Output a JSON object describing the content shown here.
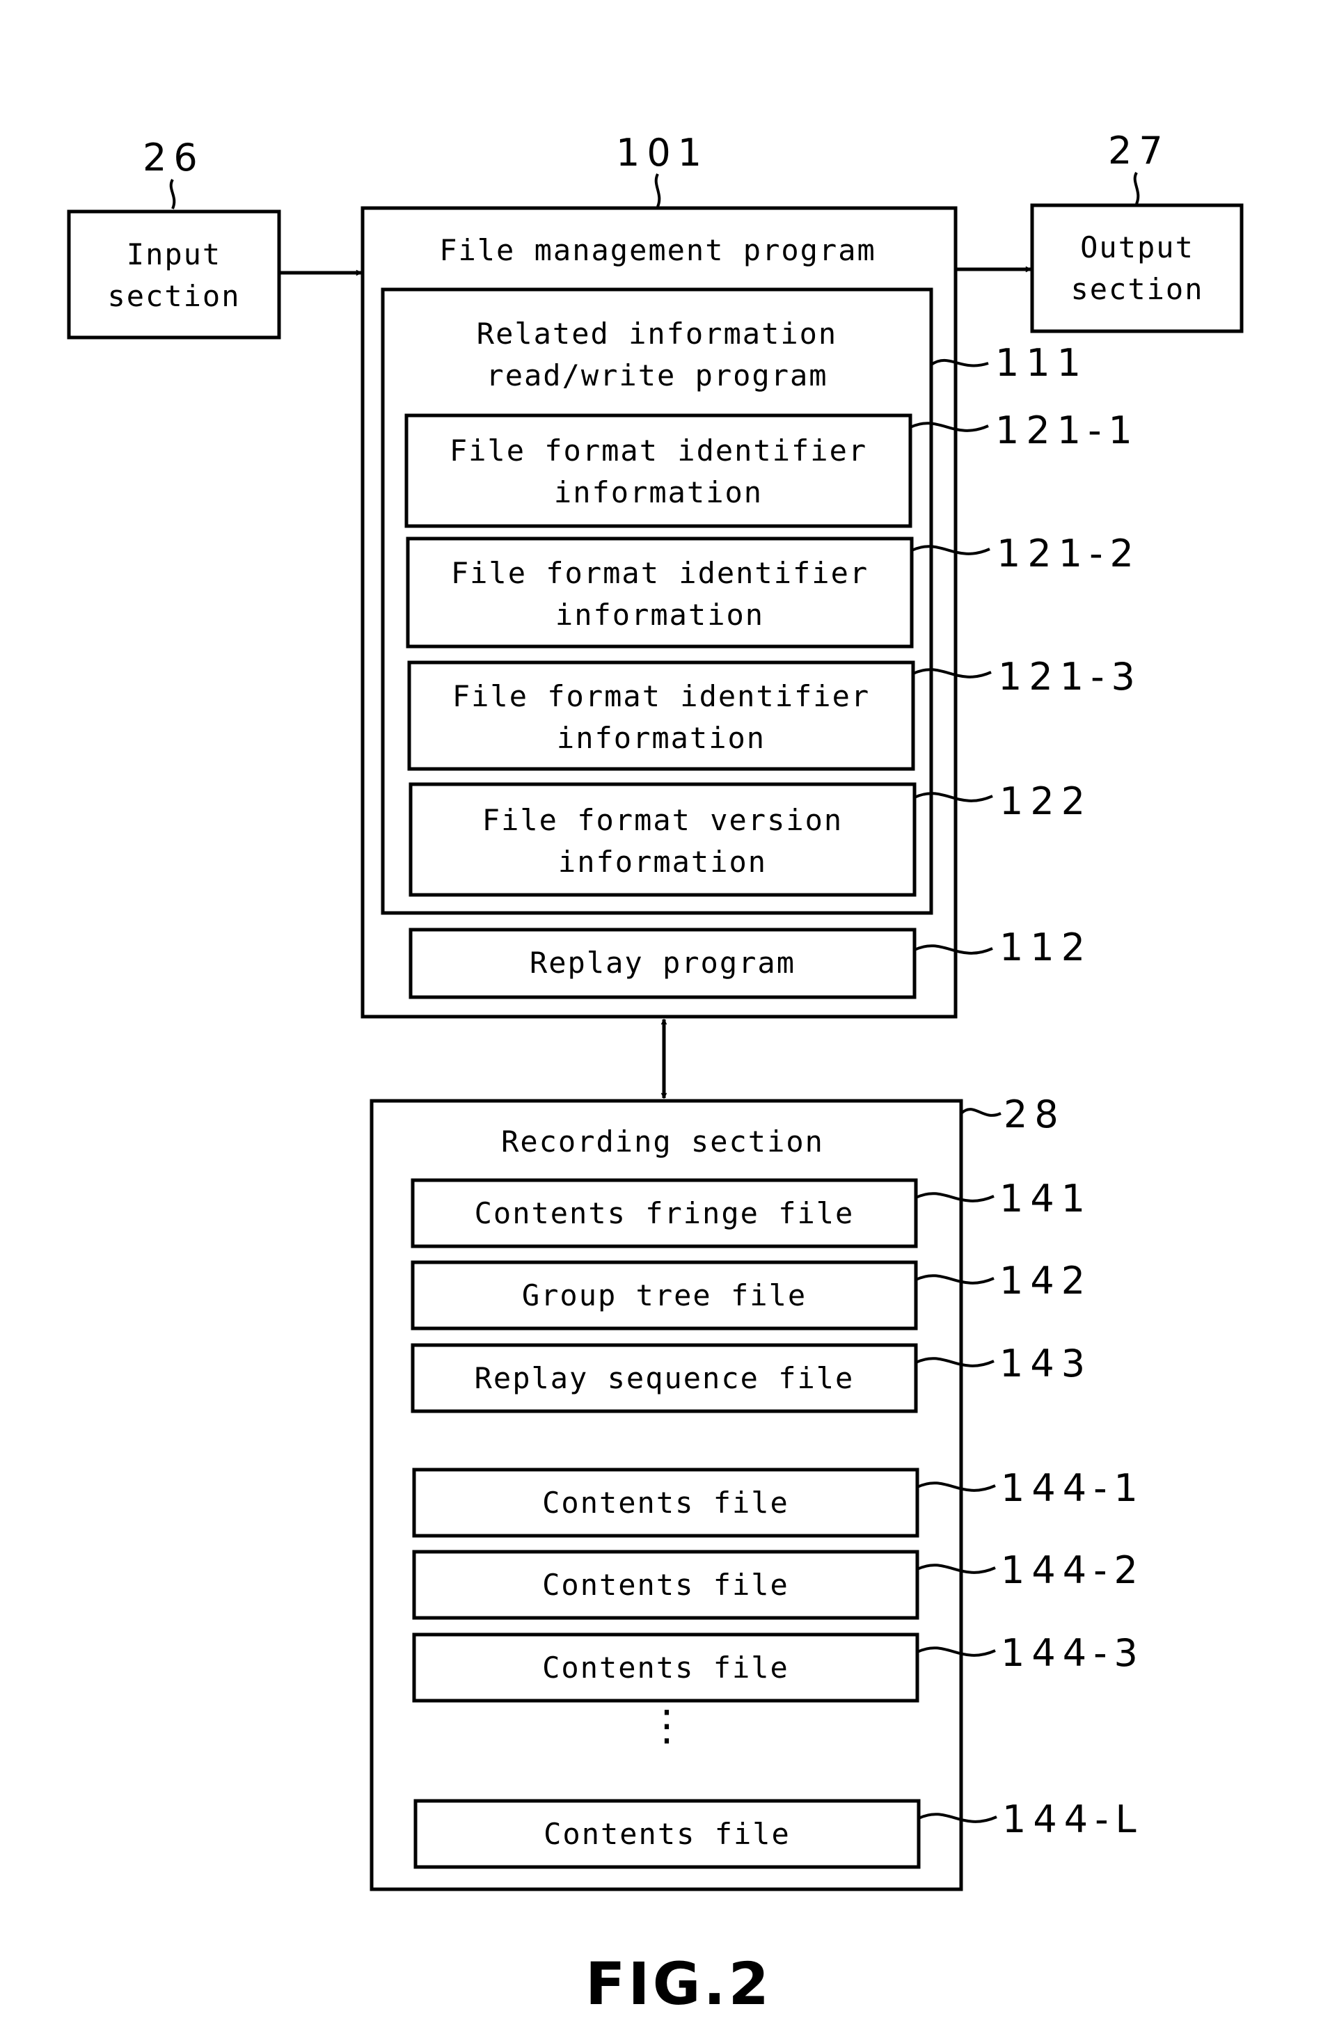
{
  "figure_label": "FIG.2",
  "input": {
    "ref": "26",
    "line1": "Input",
    "line2": "section"
  },
  "output": {
    "ref": "27",
    "line1": "Output",
    "line2": "section"
  },
  "file_management": {
    "ref": "101",
    "title": "File management program",
    "related": {
      "ref": "111",
      "line1": "Related information",
      "line2": "read/write program",
      "items": [
        {
          "ref": "121-1",
          "line1": "File format identifier",
          "line2": "information"
        },
        {
          "ref": "121-2",
          "line1": "File format identifier",
          "line2": "information"
        },
        {
          "ref": "121-3",
          "line1": "File format identifier",
          "line2": "information"
        },
        {
          "ref": "122",
          "line1": "File format version",
          "line2": "information"
        }
      ]
    },
    "replay": {
      "ref": "112",
      "label": "Replay program"
    }
  },
  "recording": {
    "ref": "28",
    "title": "Recording section",
    "files": [
      {
        "ref": "141",
        "label": "Contents fringe file"
      },
      {
        "ref": "142",
        "label": "Group tree file"
      },
      {
        "ref": "143",
        "label": "Replay sequence file"
      },
      {
        "ref": "144-1",
        "label": "Contents file"
      },
      {
        "ref": "144-2",
        "label": "Contents file"
      },
      {
        "ref": "144-3",
        "label": "Contents file"
      },
      {
        "ref": "144-L",
        "label": "Contents file"
      }
    ],
    "ellipsis": "⋮"
  }
}
